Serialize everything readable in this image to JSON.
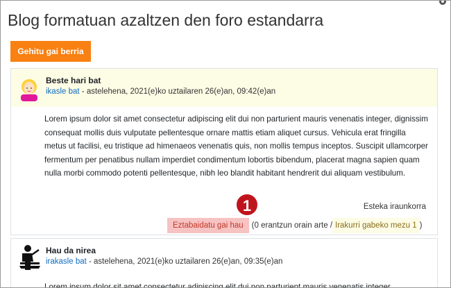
{
  "page": {
    "title": "Blog formatuan azaltzen den foro estandarra",
    "add_button": "Gehitu gai berria"
  },
  "posts": [
    {
      "subject": "Beste hari bat",
      "author": "ikasle bat",
      "date": " - astelehena, 2021(e)ko uztailaren 26(e)an, 09:42(e)an",
      "content": "Lorem ipsum dolor sit amet consectetur adipiscing elit dui non parturient mauris venenatis integer, dignissim consequat mollis duis vulputate pellentesque ornare mattis etiam aliquet cursus. Vehicula erat fringilla metus ut facilisi, eu tristique ad himenaeos venenatis quis, non mollis tempus inceptos. Suscipit ullamcorper fermentum per penatibus nullam imperdiet condimentum lobortis bibendum, placerat magna sapien quam nulla morbi commodo potenti pellentesque, nibh leo blandit habitant hendrerit dui aliquam vestibulum.",
      "permalink": "Esteka iraunkorra",
      "reply_link": "Eztabaidatu gai hau",
      "reply_meta": "(0 erantzun orain arte / ",
      "unread_link": "Irakurri gabeko mezu 1",
      "reply_close": ")"
    },
    {
      "subject": "Hau da nirea",
      "author": "irakasle bat",
      "date": " - astelehena, 2021(e)ko uztailaren 26(e)an, 09:35(e)an",
      "content": "Lorem ipsum dolor sit amet consectetur adipiscing elit dui non parturient mauris venenatis integer,"
    }
  ],
  "marker": "1",
  "colors": {
    "accent": "#f98012",
    "highlight_yellow": "#fdfde6",
    "highlight_red": "#f7c2c2",
    "marker_red": "#c0141c",
    "link": "#0f6cbf"
  },
  "icons": [
    "gear-icon",
    "student-avatar-icon",
    "teacher-avatar-icon"
  ]
}
